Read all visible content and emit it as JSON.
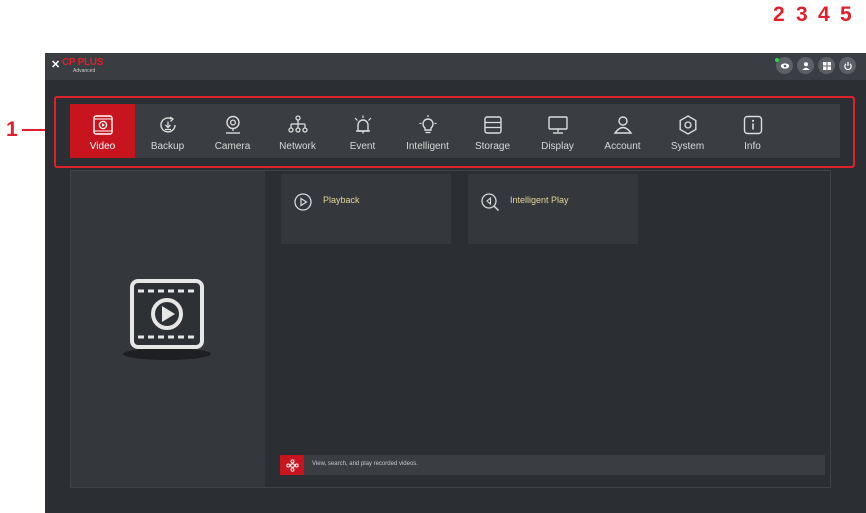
{
  "callouts": [
    "1",
    "2",
    "3",
    "4",
    "5"
  ],
  "app": {
    "logo_mark": "✕",
    "logo_text": "CP PLUS",
    "logo_sub": "Advanced"
  },
  "top_icons": [
    {
      "icon": "eye-icon"
    },
    {
      "icon": "user-icon"
    },
    {
      "icon": "grid-icon"
    },
    {
      "icon": "power-icon"
    }
  ],
  "nav": {
    "items": [
      {
        "label": "Video",
        "icon": "video-icon",
        "active": true
      },
      {
        "label": "Backup",
        "icon": "backup-icon"
      },
      {
        "label": "Camera",
        "icon": "camera-icon"
      },
      {
        "label": "Network",
        "icon": "network-icon"
      },
      {
        "label": "Event",
        "icon": "alarm-icon"
      },
      {
        "label": "Intelligent",
        "icon": "bulb-icon"
      },
      {
        "label": "Storage",
        "icon": "storage-icon"
      },
      {
        "label": "Display",
        "icon": "monitor-icon"
      },
      {
        "label": "Account",
        "icon": "user-icon"
      },
      {
        "label": "System",
        "icon": "gear-icon"
      },
      {
        "label": "Info",
        "icon": "info-icon"
      }
    ]
  },
  "cards": [
    {
      "label": "Playback",
      "icon": "play-circle-icon"
    },
    {
      "label": "Intelligent Play",
      "icon": "search-play-icon"
    }
  ],
  "hint": {
    "text": "View, search, and play recorded videos.",
    "icon": "settings-flower-icon"
  },
  "colors": {
    "accent": "#c8141e",
    "annotation": "#e0202a",
    "background": "#2b2e33",
    "card_text": "#e6d69a"
  }
}
